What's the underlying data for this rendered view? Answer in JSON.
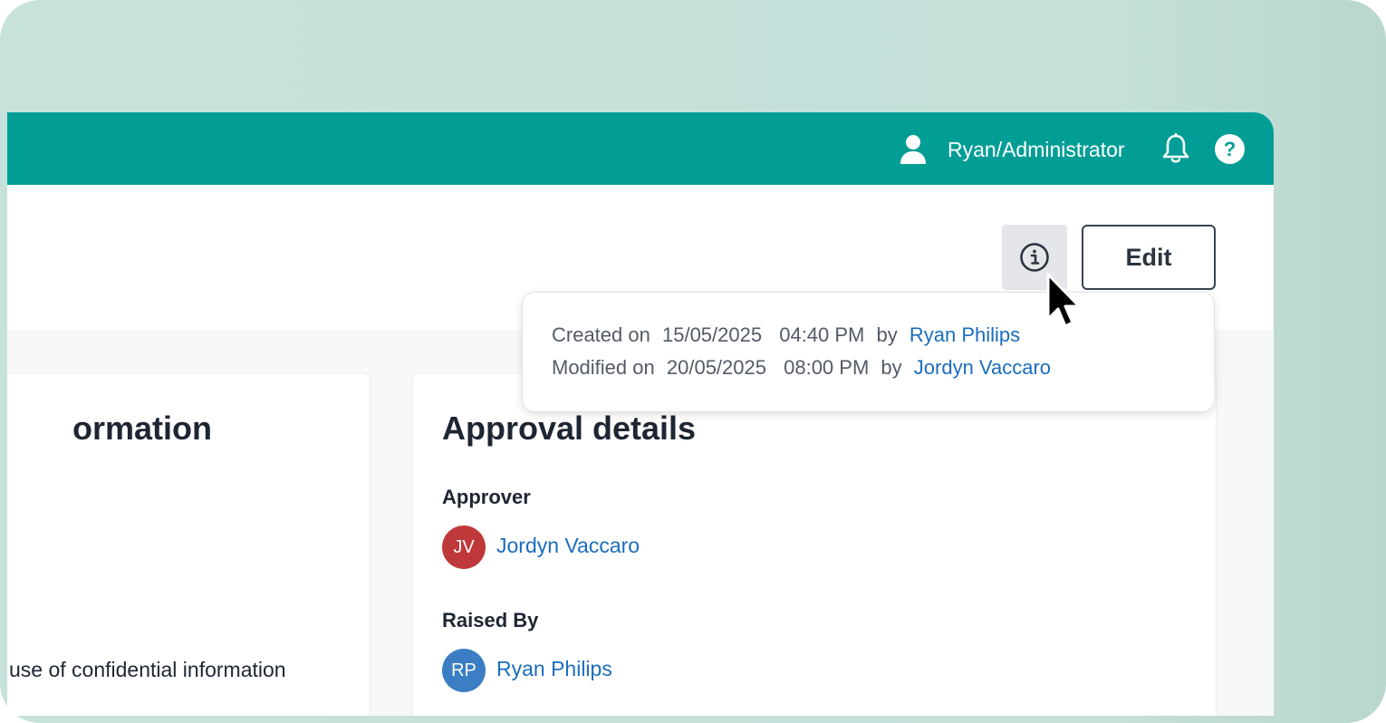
{
  "header": {
    "user_label": "Ryan/Administrator",
    "help_glyph": "?",
    "accent_color": "#029e95"
  },
  "toolbar": {
    "edit_label": "Edit"
  },
  "info_popover": {
    "created_prefix": "Created on",
    "created_date": "15/05/2025",
    "created_time": "04:40 PM",
    "created_by_word": "by",
    "created_by": "Ryan Philips",
    "modified_prefix": "Modified on",
    "modified_date": "20/05/2025",
    "modified_time": "08:00 PM",
    "modified_by_word": "by",
    "modified_by": "Jordyn Vaccaro"
  },
  "left_card": {
    "title": "ormation",
    "note": "use of confidential information"
  },
  "approval": {
    "title": "Approval details",
    "approver_label": "Approver",
    "approver": {
      "initials": "JV",
      "name": "Jordyn Vaccaro",
      "avatar_color": "#c0393a"
    },
    "raised_label": "Raised By",
    "raised_by": {
      "initials": "RP",
      "name": "Ryan Philips",
      "avatar_color": "#3b7ec3"
    }
  },
  "icons": [
    "user-icon",
    "bell-icon",
    "help-icon",
    "info-icon",
    "mouse-pointer-icon"
  ]
}
